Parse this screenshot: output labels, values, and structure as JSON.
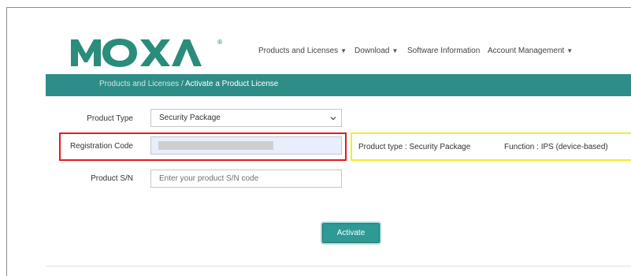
{
  "brand": {
    "name": "MOXA",
    "registered_mark": "®",
    "color": "#2a8c7a"
  },
  "nav": {
    "items": [
      {
        "label": "Products and Licenses",
        "has_dropdown": true
      },
      {
        "label": "Download",
        "has_dropdown": true
      },
      {
        "label": "Software Information",
        "has_dropdown": false
      },
      {
        "label": "Account Management",
        "has_dropdown": true
      }
    ],
    "caret": "▼"
  },
  "breadcrumb": {
    "parent": "Products and Licenses",
    "separator": " / ",
    "current": "Activate a Product License",
    "bar_color": "#2f8d88"
  },
  "form": {
    "product_type": {
      "label": "Product Type",
      "value": "Security Package"
    },
    "registration_code": {
      "label": "Registration Code",
      "value": ""
    },
    "product_sn": {
      "label": "Product S/N",
      "value": "",
      "placeholder": "Enter your product S/N code"
    },
    "activate_label": "Activate"
  },
  "info": {
    "product_type": "Product type : Security Package",
    "function": "Function : IPS (device-based)"
  },
  "highlights": {
    "red": "#e41a1c",
    "yellow": "#f2ee2a"
  },
  "icons": {
    "select_arrow": "chevron-down-icon"
  }
}
